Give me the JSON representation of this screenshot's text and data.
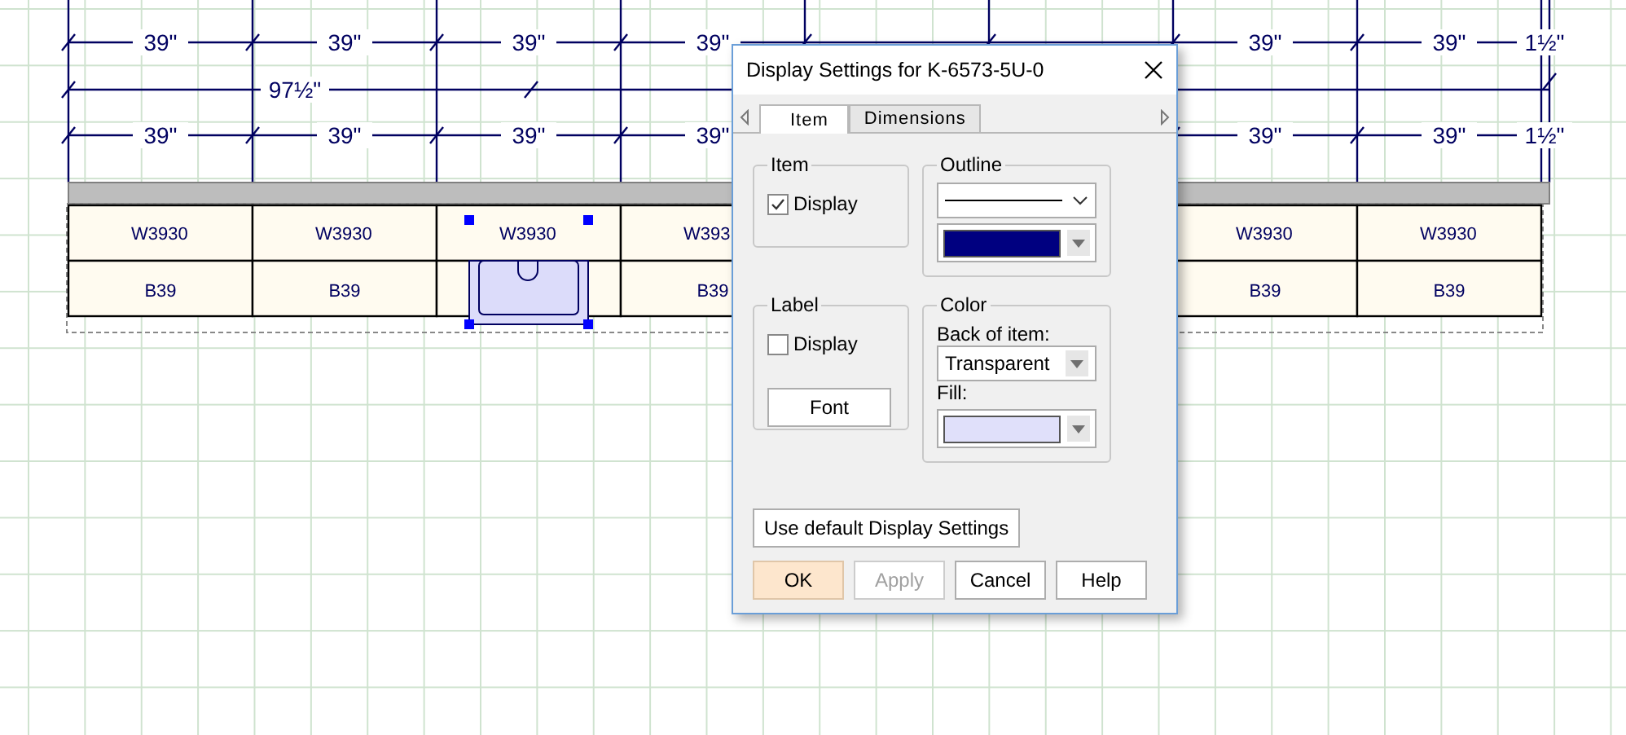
{
  "drawing": {
    "dimension_rows": [
      {
        "left_labels": [
          "39\"",
          "39\"",
          "39\"",
          "39\""
        ],
        "right_labels": [
          "39\"",
          "39\"",
          "1½\""
        ]
      },
      {
        "left_labels": [
          "39\"",
          "39\"",
          "39\"",
          "39\""
        ],
        "right_labels": [
          "39\"",
          "39\"",
          "1½\""
        ]
      }
    ],
    "overall_dimension": "97½\"",
    "wall_cabinets": {
      "left": [
        "W3930",
        "W3930",
        "W3930",
        "W393"
      ],
      "right": [
        "W3930",
        "W3930"
      ]
    },
    "base_cabinets": {
      "left": [
        "B39",
        "B39"
      ],
      "after_sink": [
        "B39"
      ],
      "right": [
        "B39",
        "B39"
      ]
    },
    "sink": {
      "selected": true
    }
  },
  "dialog": {
    "title": "Display Settings for K-6573-5U-0",
    "tabs": [
      {
        "label": "Item",
        "selected": true
      },
      {
        "label": "Dimensions",
        "selected": false
      }
    ],
    "item_group": {
      "title": "Item",
      "display": {
        "label": "Display",
        "checked": true
      }
    },
    "outline_group": {
      "title": "Outline",
      "color": "#000080"
    },
    "label_group": {
      "title": "Label",
      "display": {
        "label": "Display",
        "checked": false
      },
      "font_button": "Font"
    },
    "color_group": {
      "title": "Color",
      "back_label": "Back of item:",
      "back_value": "Transparent",
      "fill": {
        "label": "Fill:",
        "color": "#e0e0fa"
      }
    },
    "default_button": "Use default Display Settings",
    "buttons": [
      {
        "label": "OK",
        "kind": "default",
        "disabled": false
      },
      {
        "label": "Apply",
        "kind": "normal",
        "disabled": true
      },
      {
        "label": "Cancel",
        "kind": "normal",
        "disabled": false
      },
      {
        "label": "Help",
        "kind": "normal",
        "disabled": false
      }
    ]
  }
}
